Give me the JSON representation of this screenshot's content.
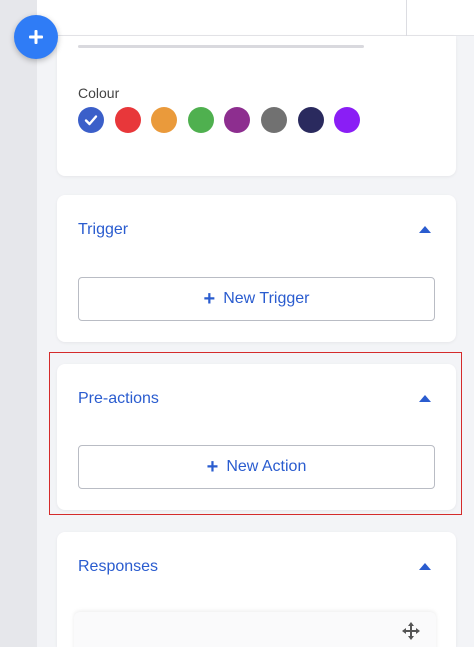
{
  "fab": {
    "icon": "plus-icon"
  },
  "colour_section": {
    "label": "Colour",
    "selected_index": 0,
    "swatches": [
      "#3b5fc9",
      "#e8373a",
      "#ea9a3b",
      "#4fb04f",
      "#8d2e8f",
      "#717171",
      "#2a2a5e",
      "#8a1ef5"
    ]
  },
  "trigger": {
    "title": "Trigger",
    "button_label": "New Trigger"
  },
  "pre_actions": {
    "title": "Pre-actions",
    "button_label": "New Action"
  },
  "responses": {
    "title": "Responses",
    "move_icon": "move-icon"
  },
  "colors": {
    "accent": "#2a5ccf",
    "highlight": "#d42b2b",
    "fab": "#2f7cf6"
  }
}
